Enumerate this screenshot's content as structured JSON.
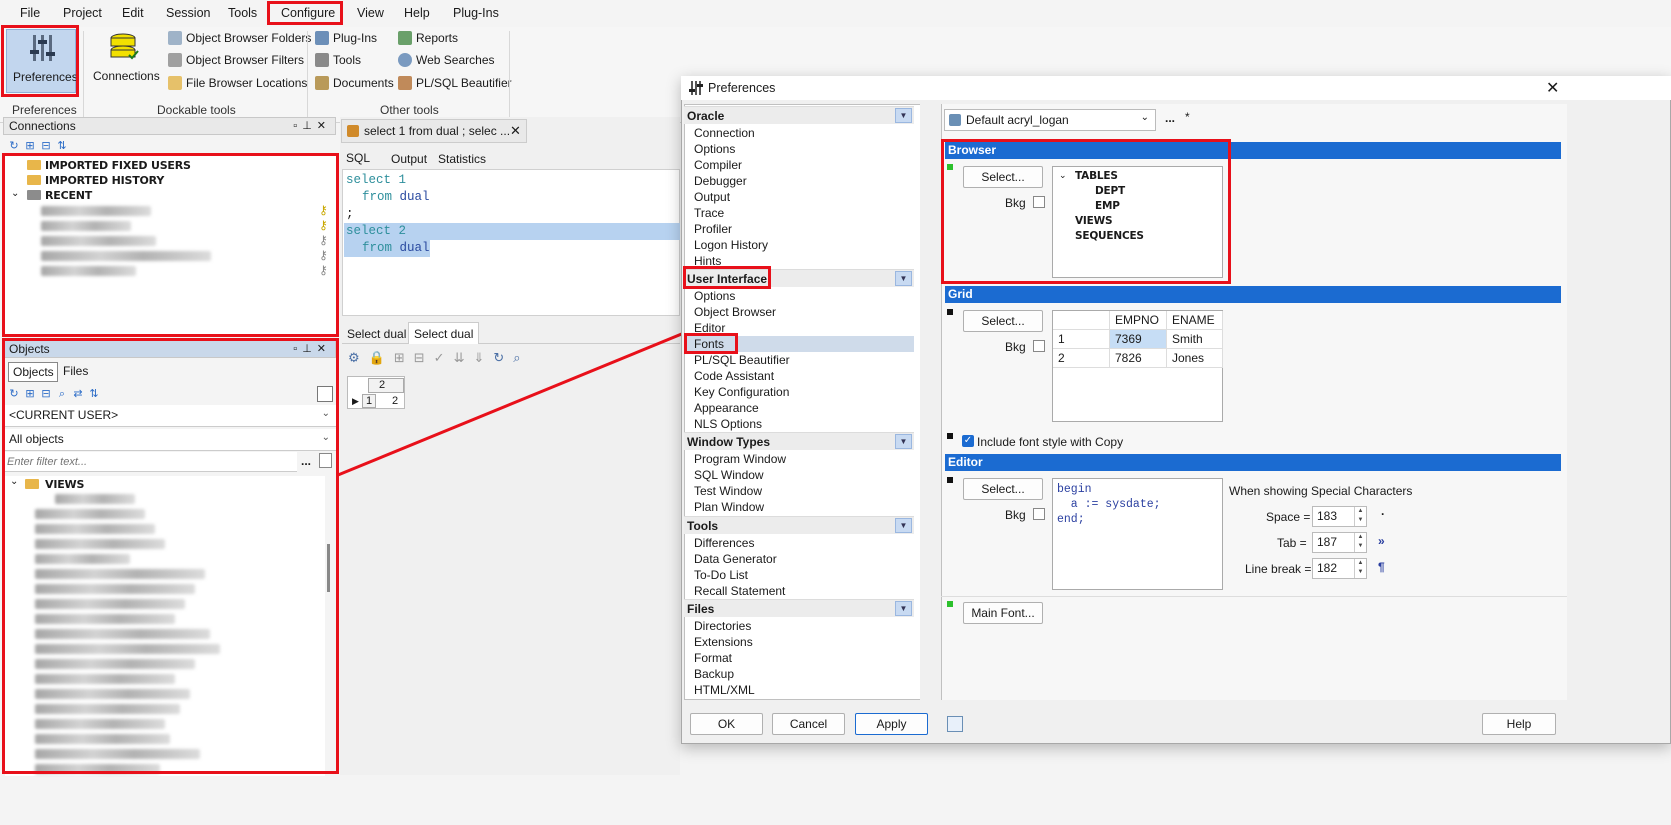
{
  "menubar": {
    "items": [
      "File",
      "Project",
      "Edit",
      "Session",
      "Tools",
      "Configure",
      "View",
      "Help",
      "Plug-Ins"
    ]
  },
  "ribbon": {
    "preferences_label": "Preferences",
    "connections_label": "Connections",
    "dockable": [
      "Object Browser Folders",
      "Object Browser Filters",
      "File Browser Locations"
    ],
    "other_left": [
      "Plug-Ins",
      "Tools",
      "Documents"
    ],
    "other_right": [
      "Reports",
      "Web Searches",
      "PL/SQL Beautifier"
    ],
    "groups": [
      "Preferences",
      "Dockable tools",
      "Other tools"
    ]
  },
  "connections_panel": {
    "title": "Connections",
    "tree": [
      "IMPORTED FIXED USERS",
      "IMPORTED HISTORY",
      "RECENT"
    ]
  },
  "objects_panel": {
    "title": "Objects",
    "tabs": [
      "Objects",
      "Files"
    ],
    "user_select": "<CURRENT USER>",
    "filter_select": "All objects",
    "filter_placeholder": "Enter filter text...",
    "folder": "VIEWS"
  },
  "editor": {
    "tab_title": "select 1 from dual ; selec ...",
    "subtabs": [
      "SQL",
      "Output",
      "Statistics"
    ],
    "lines": [
      {
        "kw1": "select",
        "rest": " 1",
        "sel": false,
        "indent": false
      },
      {
        "kw1": "from",
        "rest": " dual",
        "sel": false,
        "indent": true
      },
      {
        "kw1": ";",
        "rest": "",
        "sel": false,
        "indent": false
      },
      {
        "kw1": "select",
        "rest": " 2",
        "sel": true,
        "indent": false
      },
      {
        "kw1": "from",
        "rest": " dual",
        "sel": true,
        "indent": true
      }
    ],
    "result_tabs": [
      "Select dual",
      "Select dual"
    ],
    "result_header": "2",
    "result_row": "1",
    "result_value": "2"
  },
  "dialog": {
    "title": "Preferences",
    "categories": {
      "oracle": "Oracle",
      "oracle_items": [
        "Connection",
        "Options",
        "Compiler",
        "Debugger",
        "Output",
        "Trace",
        "Profiler",
        "Logon History",
        "Hints"
      ],
      "ui": "User Interface",
      "ui_items": [
        "Options",
        "Object Browser",
        "Editor",
        "Fonts",
        "PL/SQL Beautifier",
        "Code Assistant",
        "Key Configuration",
        "Appearance",
        "NLS Options"
      ],
      "window": "Window Types",
      "window_items": [
        "Program Window",
        "SQL Window",
        "Test Window",
        "Plan Window"
      ],
      "tools": "Tools",
      "tools_items": [
        "Differences",
        "Data Generator",
        "To-Do List",
        "Recall Statement"
      ],
      "files": "Files",
      "files_items": [
        "Directories",
        "Extensions",
        "Format",
        "Backup",
        "HTML/XML"
      ]
    },
    "profile": "Default acryl_logan",
    "profile_extra": "...",
    "profile_star": "*",
    "browser": {
      "title": "Browser",
      "select": "Select...",
      "bkg": "Bkg",
      "preview": [
        "TABLES",
        "DEPT",
        "EMP",
        "VIEWS",
        "SEQUENCES"
      ]
    },
    "grid": {
      "title": "Grid",
      "select": "Select...",
      "bkg": "Bkg",
      "headers": [
        "EMPNO",
        "ENAME"
      ],
      "rows": [
        [
          "1",
          "7369",
          "Smith"
        ],
        [
          "2",
          "7826",
          "Jones"
        ]
      ]
    },
    "include_font_style": "Include font style with Copy",
    "editor": {
      "title": "Editor",
      "select": "Select...",
      "bkg": "Bkg",
      "code": [
        "begin",
        "  a := sysdate;",
        "end;"
      ],
      "special_label": "When showing Special Characters",
      "space_label": "Space =",
      "space_value": "183",
      "space_glyph": "·",
      "tab_label": "Tab =",
      "tab_value": "187",
      "tab_glyph": "»",
      "break_label": "Line break =",
      "break_value": "182",
      "break_glyph": "¶"
    },
    "main_font": "Main Font...",
    "buttons": {
      "ok": "OK",
      "cancel": "Cancel",
      "apply": "Apply",
      "help": "Help"
    }
  }
}
